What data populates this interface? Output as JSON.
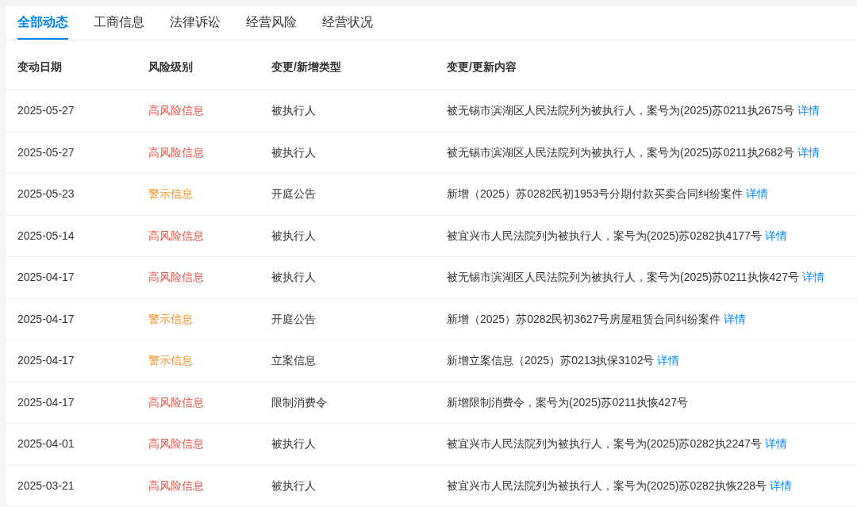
{
  "tabs": [
    {
      "label": "全部动态",
      "selected": true
    },
    {
      "label": "工商信息",
      "selected": false
    },
    {
      "label": "法律诉讼",
      "selected": false
    },
    {
      "label": "经营风险",
      "selected": false
    },
    {
      "label": "经营状况",
      "selected": false
    }
  ],
  "table": {
    "columns": [
      "变动日期",
      "风险级别",
      "变更/新增类型",
      "变更/更新内容"
    ],
    "rows": [
      {
        "date": "2025-05-27",
        "risk": {
          "text": "高风险信息",
          "kind": "high"
        },
        "type": "被执行人",
        "content": {
          "text": "被无锡市滨湖区人民法院列为被执行人，案号为(2025)苏0211执2675号",
          "link": "详情"
        }
      },
      {
        "date": "2025-05-27",
        "risk": {
          "text": "高风险信息",
          "kind": "high"
        },
        "type": "被执行人",
        "content": {
          "text": "被无锡市滨湖区人民法院列为被执行人，案号为(2025)苏0211执2682号",
          "link": "详情"
        }
      },
      {
        "date": "2025-05-23",
        "risk": {
          "text": "警示信息",
          "kind": "warning"
        },
        "type": "开庭公告",
        "content": {
          "text": "新增（2025）苏0282民初1953号分期付款买卖合同纠纷案件",
          "link": "详情"
        }
      },
      {
        "date": "2025-05-14",
        "risk": {
          "text": "高风险信息",
          "kind": "high"
        },
        "type": "被执行人",
        "content": {
          "text": "被宜兴市人民法院列为被执行人，案号为(2025)苏0282执4177号",
          "link": "详情"
        }
      },
      {
        "date": "2025-04-17",
        "risk": {
          "text": "高风险信息",
          "kind": "high"
        },
        "type": "被执行人",
        "content": {
          "text": "被无锡市滨湖区人民法院列为被执行人，案号为(2025)苏0211执恢427号",
          "link": "详情"
        }
      },
      {
        "date": "2025-04-17",
        "risk": {
          "text": "警示信息",
          "kind": "warning"
        },
        "type": "开庭公告",
        "content": {
          "text": "新增（2025）苏0282民初3627号房屋租赁合同纠纷案件",
          "link": "详情"
        }
      },
      {
        "date": "2025-04-17",
        "risk": {
          "text": "警示信息",
          "kind": "warning"
        },
        "type": "立案信息",
        "content": {
          "text": "新增立案信息（2025）苏0213执保3102号",
          "link": "详情"
        }
      },
      {
        "date": "2025-04-17",
        "risk": {
          "text": "高风险信息",
          "kind": "high"
        },
        "type": "限制消费令",
        "content": {
          "text": "新增限制消费令，案号为(2025)苏0211执恢427号"
        }
      },
      {
        "date": "2025-04-01",
        "risk": {
          "text": "高风险信息",
          "kind": "high"
        },
        "type": "被执行人",
        "content": {
          "text": "被宜兴市人民法院列为被执行人，案号为(2025)苏0282执2247号",
          "link": "详情"
        }
      },
      {
        "date": "2025-03-21",
        "risk": {
          "text": "高风险信息",
          "kind": "high"
        },
        "type": "被执行人",
        "content": {
          "text": "被宜兴市人民法院列为被执行人，案号为(2025)苏0282执恢228号",
          "link": "详情"
        }
      }
    ]
  }
}
